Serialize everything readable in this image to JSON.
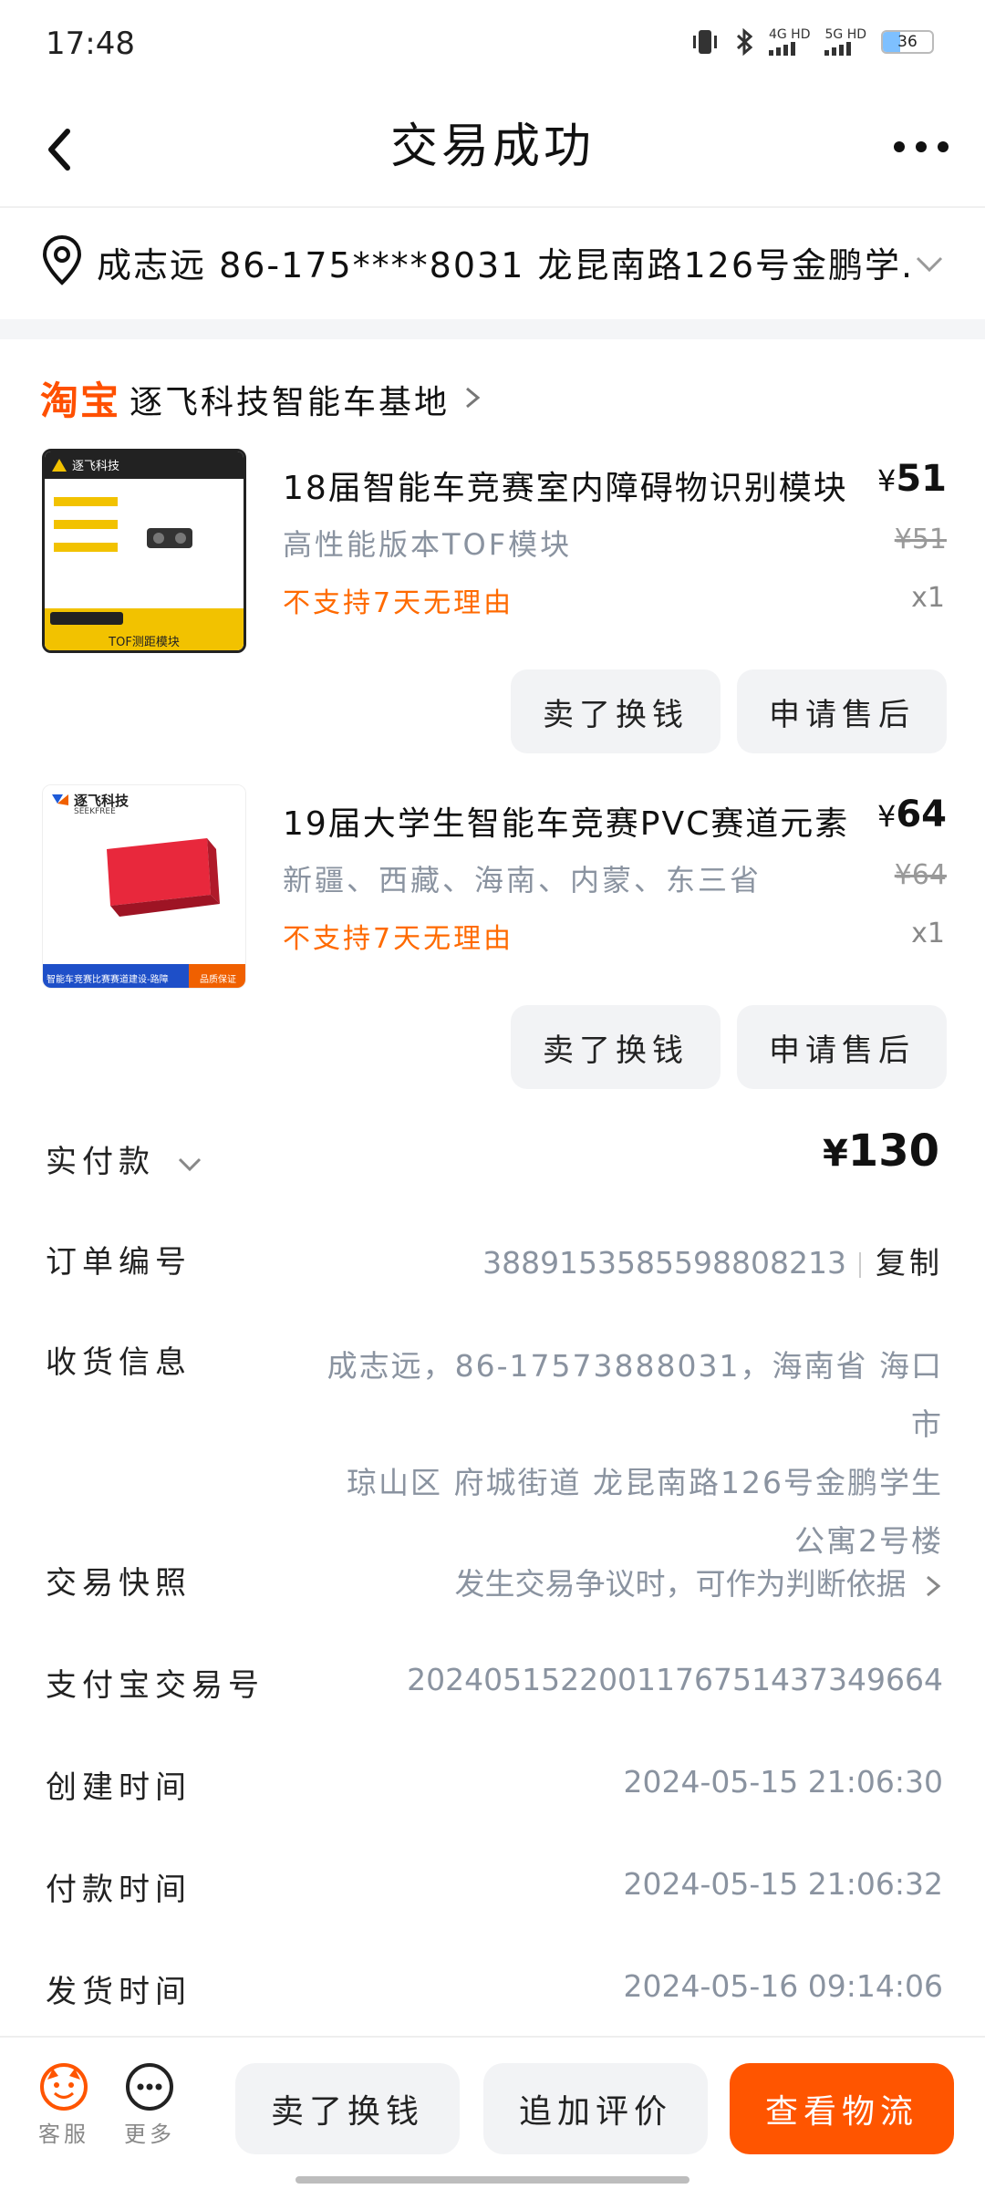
{
  "status_bar": {
    "time": "17:48",
    "net1": "4G HD",
    "net2": "5G HD",
    "battery": "36",
    "battery_level": 0.36
  },
  "nav": {
    "title": "交易成功"
  },
  "address": {
    "text": "成志远 86-175****8031 龙昆南路126号金鹏学..."
  },
  "shop": {
    "logo": "淘宝",
    "name": "逐飞科技智能车基地"
  },
  "items": [
    {
      "title": "18届智能车竞赛室内障碍物识别模块",
      "price": "51",
      "currency": "¥",
      "spec": "高性能版本TOF模块",
      "original_price": "¥51",
      "policy": "不支持7天无理由",
      "qty": "x1",
      "thumb_caption": "TOF测距模块",
      "thumb_brand": "逐飞科技",
      "buttons": [
        "卖了换钱",
        "申请售后"
      ]
    },
    {
      "title": "19届大学生智能车竞赛PVC赛道元素",
      "price": "64",
      "currency": "¥",
      "spec": "新疆、西藏、海南、内蒙、东三省",
      "original_price": "¥64",
      "policy": "不支持7天无理由",
      "qty": "x1",
      "thumb_brand": "逐飞科技",
      "thumb_brand_en": "SEEKFREE",
      "thumb_caption": "智能车竞赛比赛赛道建设-路障",
      "thumb_badge": "品质保证",
      "buttons": [
        "卖了换钱",
        "申请售后"
      ]
    }
  ],
  "details": {
    "paid_label": "实付款",
    "paid_currency": "¥",
    "paid_amount": "130",
    "order_no_label": "订单编号",
    "order_no": "3889153585598808213",
    "copy_label": "复制",
    "receiver_label": "收货信息",
    "receiver_line1": "成志远，86-17573888031，海南省 海口市",
    "receiver_line2": "琼山区 府城街道 龙昆南路126号金鹏学生",
    "receiver_line3": "公寓2号楼",
    "snapshot_label": "交易快照",
    "snapshot_value": "发生交易争议时，可作为判断依据",
    "alipay_label": "支付宝交易号",
    "alipay_no": "2024051522001176751437349664",
    "created_label": "创建时间",
    "created_time": "2024-05-15 21:06:30",
    "paid_time_label": "付款时间",
    "paid_time": "2024-05-15 21:06:32",
    "shipped_label": "发货时间",
    "shipped_time": "2024-05-16 09:14:06"
  },
  "bottom_bar": {
    "service_label": "客服",
    "more_label": "更多",
    "sell_label": "卖了换钱",
    "review_label": "追加评价",
    "logistics_label": "查看物流"
  },
  "colors": {
    "accent": "#ff5500",
    "policy": "#ff6a00",
    "muted": "#8a93a0"
  }
}
